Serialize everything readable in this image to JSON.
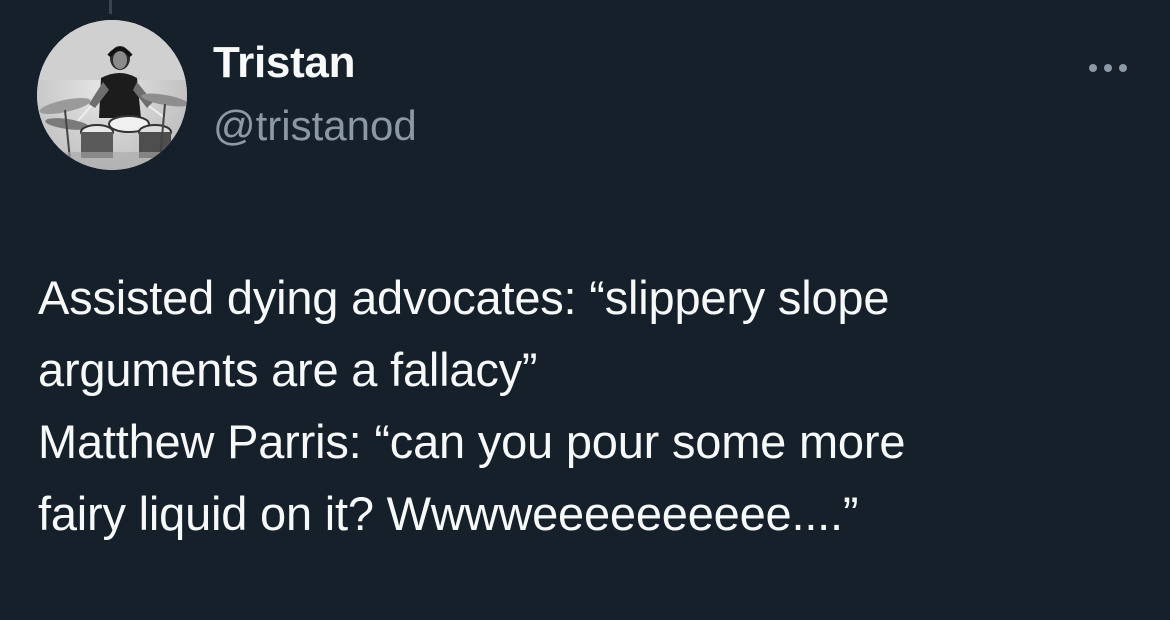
{
  "author": {
    "display_name": "Tristan",
    "handle": "@tristanod",
    "avatar_icon": "profile-photo-drummer"
  },
  "more_icon": "ellipsis-icon",
  "tweet": {
    "lines": [
      "Assisted dying advocates: “slippery slope",
      "arguments are a fallacy”",
      "Matthew Parris: “can you pour some more",
      "fairy liquid on it? Wwwweeeeeeeeee....”"
    ]
  },
  "colors": {
    "background": "#15202b",
    "primary_text": "#f7f9f9",
    "secondary_text": "#8b98a5"
  }
}
